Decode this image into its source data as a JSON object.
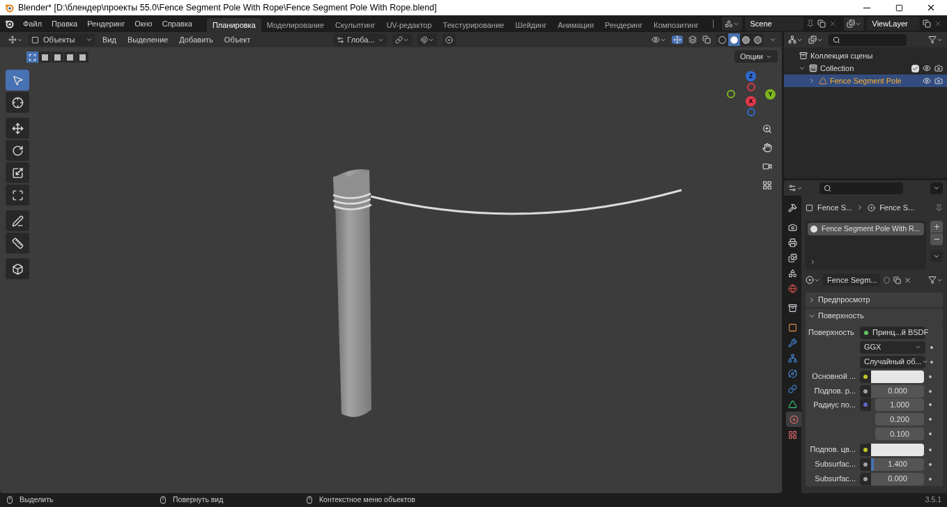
{
  "title_bar": {
    "title": "Blender* [D:\\блендер\\проекты 55.0\\Fence Segment Pole With Rope\\Fence Segment Pole With Rope.blend]"
  },
  "menu": [
    "Файл",
    "Правка",
    "Рендеринг",
    "Окно",
    "Справка"
  ],
  "workspaces": [
    {
      "label": "Планировка",
      "selected": true
    },
    {
      "label": "Моделирование",
      "selected": false
    },
    {
      "label": "Скульптинг",
      "selected": false
    },
    {
      "label": "UV-редактор",
      "selected": false
    },
    {
      "label": "Текстурирование",
      "selected": false
    },
    {
      "label": "Шейдинг",
      "selected": false
    },
    {
      "label": "Анимация",
      "selected": false
    },
    {
      "label": "Рендеринг",
      "selected": false
    },
    {
      "label": "Композитинг",
      "selected": false
    }
  ],
  "scene": {
    "name": "Scene"
  },
  "view_layer": {
    "name": "ViewLayer"
  },
  "viewport": {
    "mode": "Объекты",
    "menus": [
      "Вид",
      "Выделение",
      "Добавить",
      "Объект"
    ],
    "transform_orientation": "Глоба...",
    "options": "Опции",
    "select_modes": [
      {
        "selected": true
      },
      {
        "selected": false
      },
      {
        "selected": false
      },
      {
        "selected": false
      },
      {
        "selected": false
      }
    ],
    "shading": [
      {
        "kind": "wireframe",
        "selected": false
      },
      {
        "kind": "solid",
        "selected": true
      },
      {
        "kind": "material",
        "selected": false
      },
      {
        "kind": "rendered",
        "selected": false
      }
    ],
    "tools": [
      {
        "kind": "select",
        "selected": true
      },
      {
        "kind": "cursor",
        "selected": false
      },
      {
        "kind": "move",
        "selected": false
      },
      {
        "kind": "rotate",
        "selected": false
      },
      {
        "kind": "scale",
        "selected": false
      },
      {
        "kind": "transform",
        "selected": false
      },
      {
        "kind": "annotate",
        "selected": false
      },
      {
        "kind": "measure",
        "selected": false
      },
      {
        "kind": "add-cube",
        "selected": false
      }
    ],
    "gizmo": [
      {
        "label": "Z",
        "color": "#2f6bd2"
      },
      {
        "label": "Y",
        "color": "#7cb51e"
      },
      {
        "label": "X",
        "color": "#e0384a"
      }
    ]
  },
  "outliner": {
    "items": [
      {
        "label": "Коллекция сцены",
        "kind": "scene",
        "selected": false,
        "children": [
          {
            "label": "Collection",
            "kind": "collection",
            "expanded": true,
            "checked": true,
            "selected": false,
            "children": [
              {
                "label": "Fence Segment Pole",
                "kind": "object",
                "expanded": false,
                "selected": true
              }
            ]
          }
        ]
      }
    ]
  },
  "properties": {
    "tabs": [
      {
        "kind": "tool",
        "selected": false
      },
      {
        "kind": "render",
        "selected": false
      },
      {
        "kind": "output",
        "selected": false
      },
      {
        "kind": "view-layer",
        "selected": false
      },
      {
        "kind": "scene",
        "selected": false
      },
      {
        "kind": "world",
        "selected": false
      },
      {
        "kind": "collection",
        "selected": false
      },
      {
        "kind": "object",
        "selected": false
      },
      {
        "kind": "modifier",
        "selected": false
      },
      {
        "kind": "particles",
        "selected": false
      },
      {
        "kind": "physics",
        "selected": false
      },
      {
        "kind": "constraints",
        "selected": false
      },
      {
        "kind": "data",
        "selected": false
      },
      {
        "kind": "material",
        "selected": true
      },
      {
        "kind": "texture",
        "selected": false
      }
    ],
    "breadcrumb": [
      "Fence S...",
      "Fence S..."
    ],
    "slots": [
      "Fence Segment Pole With R..."
    ],
    "material": "Fence Segm...",
    "panels": [
      {
        "title": "Предпросмотр",
        "expanded": false
      },
      {
        "title": "Поверхность",
        "expanded": true
      }
    ],
    "rows": [
      {
        "kind": "link",
        "label": "Поверхность",
        "value": "Принц...й BSDF",
        "color": "#63c763"
      },
      {
        "kind": "dropdown",
        "value": "GGX"
      },
      {
        "kind": "dropdown",
        "value": "Случайный об..."
      },
      {
        "kind": "color",
        "label": "Основной ...",
        "color": "#c7c729"
      },
      {
        "kind": "number",
        "label": "Подпов. р...",
        "value": "0.000",
        "color": "#a1a1a1"
      },
      {
        "kind": "vector",
        "label": "Радиус по...",
        "values": [
          "1.000",
          "0.200",
          "0.100"
        ],
        "color": "#6363c7"
      },
      {
        "kind": "color",
        "label": "Подпов. цв...",
        "color": "#c7c729"
      },
      {
        "kind": "slider",
        "label": "Subsurfac...",
        "value": "1.400",
        "level": 0.05,
        "color": "#a1a1a1"
      },
      {
        "kind": "number",
        "label": "Subsurfac...",
        "value": "0.000",
        "color": "#a1a1a1"
      }
    ]
  },
  "status_bar": {
    "hints": [
      "Выделить",
      "Повернуть вид",
      "Контекстное меню объектов"
    ],
    "version": "3.5.1"
  }
}
